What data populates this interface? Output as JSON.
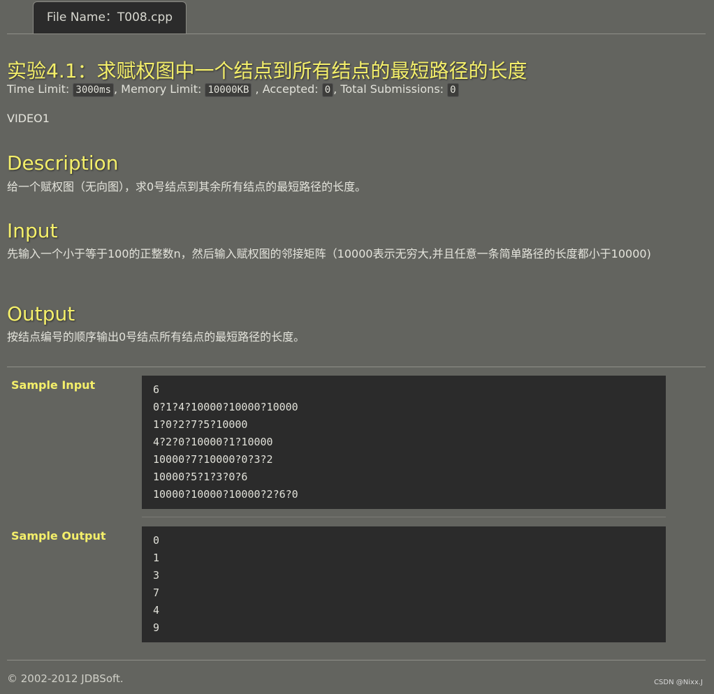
{
  "tab": {
    "label": "File Name：T008.cpp"
  },
  "problem": {
    "title": "实验4.1：求赋权图中一个结点到所有结点的最短路径的长度",
    "time_limit_label": "Time Limit: ",
    "time_limit": "3000ms",
    "memory_limit_label": ", Memory Limit: ",
    "memory_limit": "10000KB",
    "accepted_label": " , Accepted: ",
    "accepted": "0",
    "submissions_label": ", Total Submissions: ",
    "submissions": "0",
    "source": "VIDEO1"
  },
  "sections": {
    "description_heading": "Description",
    "description_text": "给一个赋权图（无向图），求0号结点到其余所有结点的最短路径的长度。",
    "input_heading": "Input",
    "input_text": "先输入一个小于等于100的正整数n，然后输入赋权图的邻接矩阵（10000表示无穷大,并且任意一条简单路径的长度都小于10000)",
    "output_heading": "Output",
    "output_text": "按结点编号的顺序输出0号结点所有结点的最短路径的长度。"
  },
  "sample_input": {
    "label": "Sample Input",
    "lines": [
      "6",
      "0?1?4?10000?10000?10000",
      "1?0?2?7?5?10000",
      "4?2?0?10000?1?10000",
      "10000?7?10000?0?3?2",
      "10000?5?1?3?0?6",
      "10000?10000?10000?2?6?0"
    ]
  },
  "sample_output": {
    "label": "Sample Output",
    "lines": [
      "0",
      "1",
      "3",
      "7",
      "4",
      "9"
    ]
  },
  "footer": {
    "copyright": "© 2002-2012  JDBSoft.",
    "watermark": "CSDN @Nixx.J"
  }
}
